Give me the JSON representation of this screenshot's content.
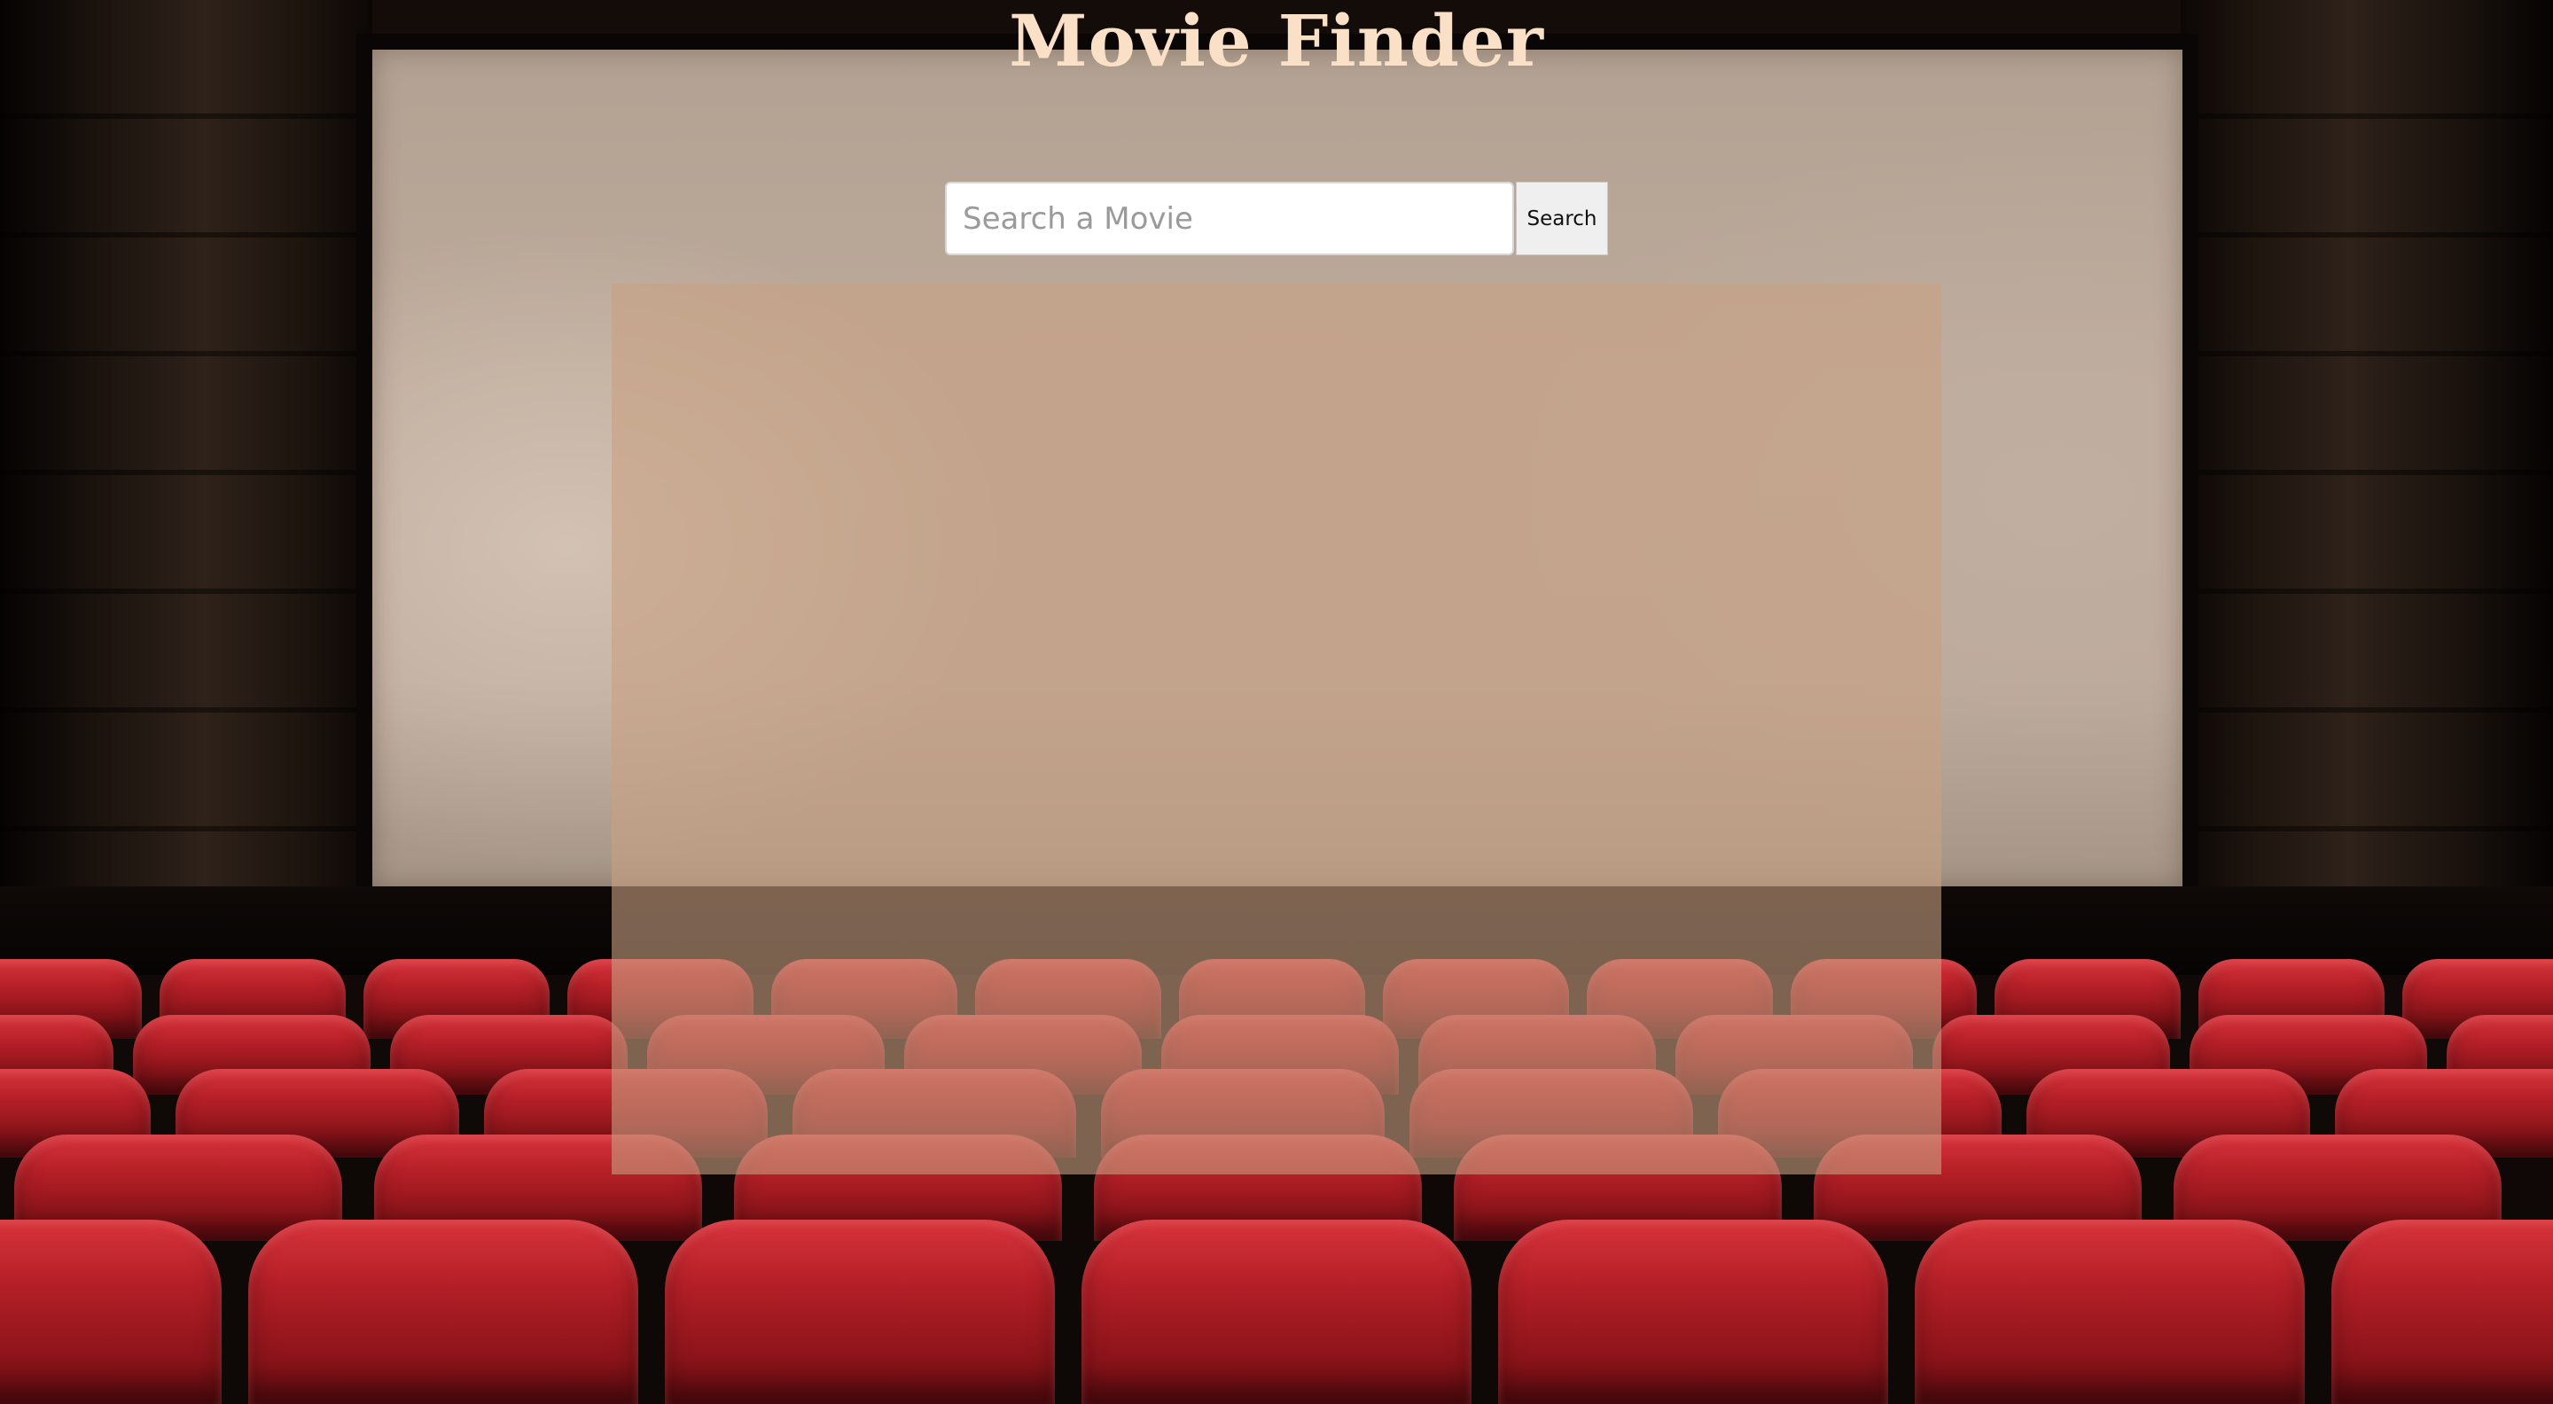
{
  "header": {
    "title": "Movie Finder"
  },
  "search": {
    "placeholder": "Search a Movie",
    "value": "",
    "button_label": "Search"
  },
  "results": {
    "items": []
  },
  "colors": {
    "title": "#fbe0c8",
    "results_panel": "#c8a082",
    "seat": "#b51f27",
    "screen": "#bca99a"
  }
}
